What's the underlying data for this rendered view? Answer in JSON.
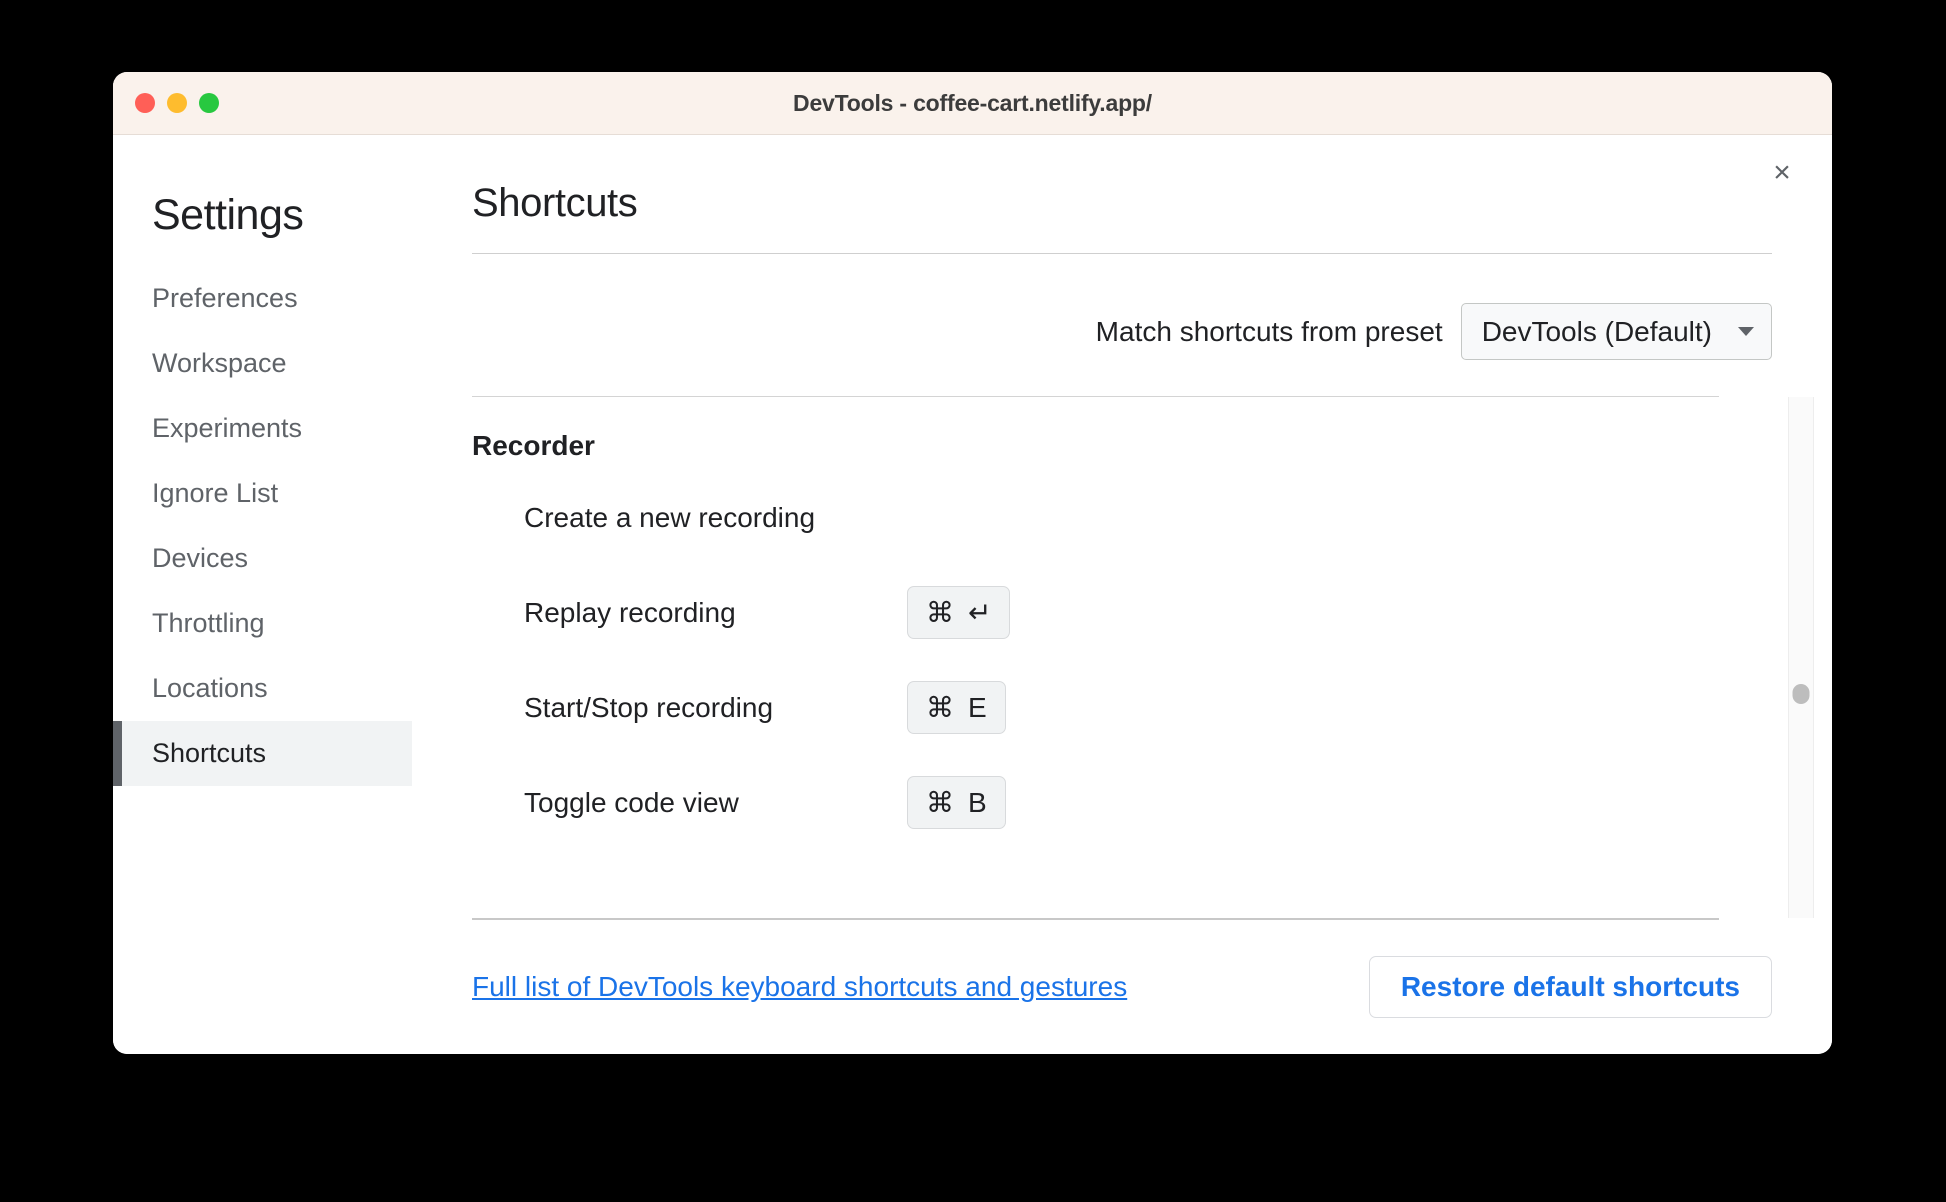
{
  "window": {
    "title": "DevTools - coffee-cart.netlify.app/",
    "traffic_lights": [
      {
        "name": "close",
        "color": "#ff5f57"
      },
      {
        "name": "minimize",
        "color": "#febc2e"
      },
      {
        "name": "zoom",
        "color": "#28c840"
      }
    ]
  },
  "sidebar": {
    "title": "Settings",
    "items": [
      {
        "label": "Preferences",
        "selected": false
      },
      {
        "label": "Workspace",
        "selected": false
      },
      {
        "label": "Experiments",
        "selected": false
      },
      {
        "label": "Ignore List",
        "selected": false
      },
      {
        "label": "Devices",
        "selected": false
      },
      {
        "label": "Throttling",
        "selected": false
      },
      {
        "label": "Locations",
        "selected": false
      },
      {
        "label": "Shortcuts",
        "selected": true
      }
    ]
  },
  "content": {
    "title": "Shortcuts",
    "close_icon": "×",
    "preset": {
      "label": "Match shortcuts from preset",
      "value": "DevTools (Default)",
      "caret_icon": "chevron-down-icon"
    },
    "groups": [
      {
        "title": "Recorder",
        "shortcuts": [
          {
            "name": "Create a new recording",
            "keys": []
          },
          {
            "name": "Replay recording",
            "keys": [
              "⌘",
              "↵"
            ]
          },
          {
            "name": "Start/Stop recording",
            "keys": [
              "⌘",
              "E"
            ]
          },
          {
            "name": "Toggle code view",
            "keys": [
              "⌘",
              "B"
            ]
          }
        ]
      }
    ]
  },
  "footer": {
    "link_text": "Full list of DevTools keyboard shortcuts and gestures",
    "restore_label": "Restore default shortcuts"
  },
  "colors": {
    "accent_blue": "#1a73e8",
    "selected_bg": "#f1f3f4",
    "selected_bar": "#5f6368",
    "titlebar_bg": "#faf2ec",
    "text_primary": "#202124",
    "text_secondary": "#5f6368"
  }
}
